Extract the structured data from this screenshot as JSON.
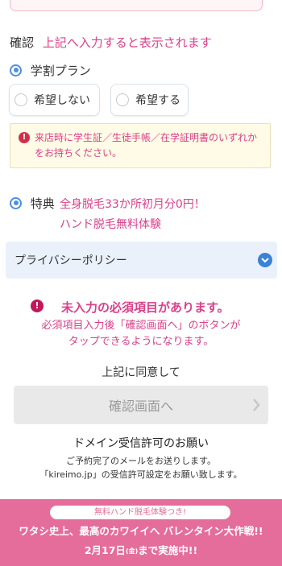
{
  "confirm": {
    "label": "確認",
    "message": "上記へ入力すると表示されます"
  },
  "student_plan": {
    "title": "学割プラン",
    "options": [
      "希望しない",
      "希望する"
    ]
  },
  "alert": {
    "text": "来店時に学生証／生徒手帳／在学証明書のいずれかをお持ちください。"
  },
  "tokuten": {
    "label": "特典",
    "line1": "全身脱毛33か所初月分0円！",
    "line2": "ハンド脱毛無料体験"
  },
  "privacy": {
    "label": "プライバシーポリシー"
  },
  "error": {
    "heading": "未入力の必須項目があります。",
    "line1": "必須項目入力後「確認画面へ」のボタンが",
    "line2": "タップできるようになります。"
  },
  "agree": {
    "text": "上記に同意して",
    "button": "確認画面へ"
  },
  "domain": {
    "title": "ドメイン受信許可のお願い",
    "line1": "ご予約完了のメールをお送りします。",
    "line2": "「kireimo.jp」の受信許可設定をお願い致します。"
  },
  "banner": {
    "pill": "無料ハンド脱毛体験つき!",
    "line1": "ワタシ史上、最高のカワイイへ バレンタイン大作戦!!",
    "date": "2月17日",
    "weekday": "(金)",
    "line2_rest": "まで実施中!!"
  },
  "colors": {
    "accent_pink": "#d9418a",
    "radio_blue": "#4f8ee0",
    "privacy_bg": "#eaf1fb",
    "banner_bg": "#e46d9b"
  },
  "icons": [
    "radio-selected-icon",
    "radio-unselected-icon",
    "exclamation-icon",
    "chevron-down-icon",
    "chevron-right-icon"
  ]
}
